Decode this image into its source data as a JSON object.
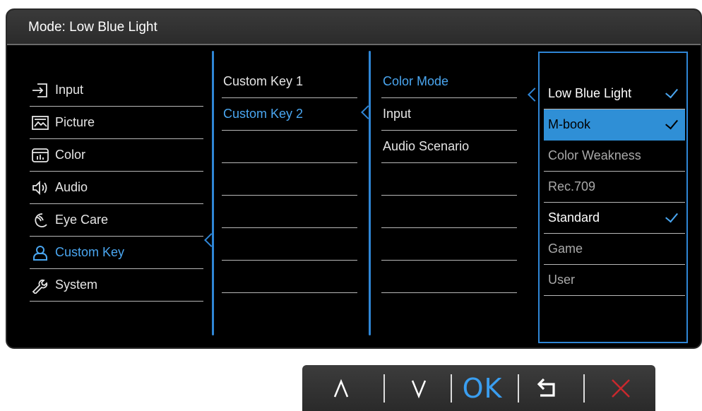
{
  "header": {
    "title": "Mode: Low Blue Light"
  },
  "main_menu": [
    {
      "label": "Input",
      "icon": "input-icon",
      "active": false
    },
    {
      "label": "Picture",
      "icon": "picture-icon",
      "active": false
    },
    {
      "label": "Color",
      "icon": "color-icon",
      "active": false
    },
    {
      "label": "Audio",
      "icon": "audio-icon",
      "active": false
    },
    {
      "label": "Eye Care",
      "icon": "eye-care-icon",
      "active": false
    },
    {
      "label": "Custom Key",
      "icon": "custom-key-icon",
      "active": true
    },
    {
      "label": "System",
      "icon": "system-icon",
      "active": false
    }
  ],
  "submenu": [
    {
      "label": "Custom Key 1",
      "active": false
    },
    {
      "label": "Custom Key 2",
      "active": true
    }
  ],
  "function_menu": [
    {
      "label": "Color Mode",
      "active": true
    },
    {
      "label": "Input",
      "active": false
    },
    {
      "label": "Audio Scenario",
      "active": false
    }
  ],
  "options": [
    {
      "label": "Low Blue Light",
      "checked": true,
      "selected": false,
      "bright": true
    },
    {
      "label": "M-book",
      "checked": true,
      "selected": true,
      "bright": false
    },
    {
      "label": "Color Weakness",
      "checked": false,
      "selected": false,
      "bright": false
    },
    {
      "label": "Rec.709",
      "checked": false,
      "selected": false,
      "bright": false
    },
    {
      "label": "Standard",
      "checked": true,
      "selected": false,
      "bright": true
    },
    {
      "label": "Game",
      "checked": false,
      "selected": false,
      "bright": false
    },
    {
      "label": "User",
      "checked": false,
      "selected": false,
      "bright": false
    }
  ],
  "keys": {
    "up_icon": "up-arrow-icon",
    "down_icon": "down-arrow-icon",
    "ok_label": "OK",
    "back_icon": "back-icon",
    "close_icon": "close-icon"
  },
  "colors": {
    "accent": "#2f86d6",
    "selected_bg": "#2f8fd6",
    "close": "#c8282d"
  }
}
